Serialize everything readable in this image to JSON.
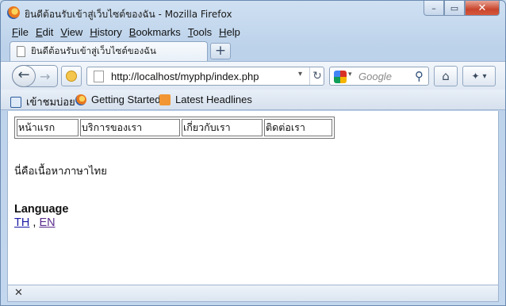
{
  "window": {
    "title": "ยินดีต้อนรับเข้าสู่เว็บไซต์ของฉัน - Mozilla Firefox",
    "controls": {
      "minimize": "–",
      "maximize": "▭",
      "close": "✕"
    }
  },
  "menu": {
    "items": [
      {
        "accel": "F",
        "rest": "ile"
      },
      {
        "accel": "E",
        "rest": "dit"
      },
      {
        "accel": "V",
        "rest": "iew"
      },
      {
        "accel": "H",
        "rest": "istory"
      },
      {
        "accel": "B",
        "rest": "ookmarks"
      },
      {
        "accel": "T",
        "rest": "ools"
      },
      {
        "accel": "H",
        "rest": "elp"
      }
    ]
  },
  "tabs": [
    {
      "label": "ยินดีต้อนรับเข้าสู่เว็บไซต์ของฉัน"
    }
  ],
  "new_tab_label": "+",
  "toolbar": {
    "url": "http://localhost/myphp/index.php",
    "search_placeholder": "Google",
    "back_glyph": "←",
    "forward_glyph": "→",
    "reload_glyph": "↻",
    "home_glyph": "⌂",
    "search_glyph": "⚲",
    "menu_glyph": "▾"
  },
  "bookmarks": [
    {
      "label": "เข้าชมบ่อย",
      "icon": "bookmark-help-icon"
    },
    {
      "label": "Getting Started",
      "icon": "firefox-icon"
    },
    {
      "label": "Latest Headlines",
      "icon": "rss-icon"
    }
  ],
  "page": {
    "nav_menu": [
      "หน้าแรก",
      "บริการของเรา",
      "เกี่ยวกับเรา",
      "ติดต่อเรา"
    ],
    "body_text": "นี่คือเนื้อหาภาษาไทย",
    "language_heading": "Language",
    "language_links": [
      "TH",
      "EN"
    ],
    "language_separator": " , "
  },
  "addon_bar": {
    "close_glyph": "✕"
  }
}
